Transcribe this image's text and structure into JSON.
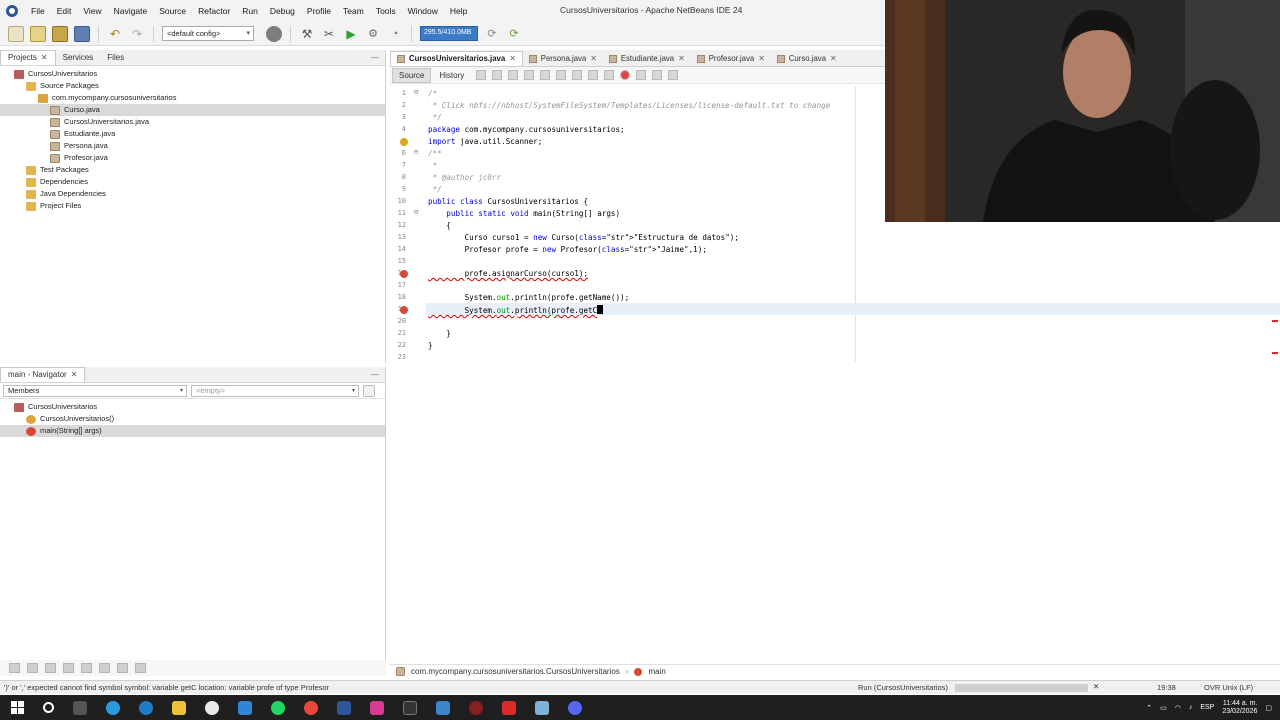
{
  "app": {
    "window_title": "CursosUniversitarios - Apache NetBeans IDE 24"
  },
  "menu": {
    "items": [
      "File",
      "Edit",
      "View",
      "Navigate",
      "Source",
      "Refactor",
      "Run",
      "Debug",
      "Profile",
      "Team",
      "Tools",
      "Window",
      "Help"
    ]
  },
  "toolbar": {
    "config_value": "<default config>",
    "memory_label": "295.5/410.0MB"
  },
  "projects_pane": {
    "tabs": [
      "Projects",
      "Services",
      "Files"
    ],
    "tree": [
      {
        "label": "CursosUniversitarios",
        "indent": 0
      },
      {
        "label": "Source Packages",
        "indent": 1
      },
      {
        "label": "com.mycompany.cursosuniversitarios",
        "indent": 2
      },
      {
        "label": "Curso.java",
        "indent": 3,
        "selected": true
      },
      {
        "label": "CursosUniversitarios.java",
        "indent": 3
      },
      {
        "label": "Estudiante.java",
        "indent": 3
      },
      {
        "label": "Persona.java",
        "indent": 3
      },
      {
        "label": "Profesor.java",
        "indent": 3
      },
      {
        "label": "Test Packages",
        "indent": 1
      },
      {
        "label": "Dependencies",
        "indent": 1
      },
      {
        "label": "Java Dependencies",
        "indent": 1
      },
      {
        "label": "Project Files",
        "indent": 1
      }
    ]
  },
  "navigator": {
    "title": "main - Navigator",
    "filter": "Members",
    "empty_select": "<empty>",
    "tree": [
      {
        "label": "CursosUniversitarios",
        "indent": 0
      },
      {
        "label": "CursosUniversitarios()",
        "indent": 1
      },
      {
        "label": "main(String[] args)",
        "indent": 1,
        "selected": true
      }
    ]
  },
  "editor": {
    "tabs": [
      {
        "label": "CursosUniversitarios.java",
        "active": true
      },
      {
        "label": "Persona.java"
      },
      {
        "label": "Estudiante.java"
      },
      {
        "label": "Profesor.java"
      },
      {
        "label": "Curso.java"
      }
    ],
    "subtabs": [
      "Source",
      "History"
    ],
    "lines": [
      {
        "n": "1",
        "text": "/*"
      },
      {
        "n": "2",
        "text": " * Click nbfs://nbhost/SystemFileSystem/Templates/Licenses/license-default.txt to change"
      },
      {
        "n": "3",
        "text": " */"
      },
      {
        "n": "4",
        "text": "package com.mycompany.cursosuniversitarios;"
      },
      {
        "n": "5",
        "text": "import java.util.Scanner;"
      },
      {
        "n": "6",
        "text": "/**"
      },
      {
        "n": "7",
        "text": " *"
      },
      {
        "n": "8",
        "text": " * @author jc0rr"
      },
      {
        "n": "9",
        "text": " */"
      },
      {
        "n": "10",
        "text": "public class CursosUniversitarios {"
      },
      {
        "n": "11",
        "text": "    public static void main(String[] args)"
      },
      {
        "n": "12",
        "text": "    {"
      },
      {
        "n": "13",
        "text": "        Curso curso1 = new Curso(\"Estructura de datos\");"
      },
      {
        "n": "14",
        "text": "        Profesor profe = new Profesor(\"Jaime\",1);"
      },
      {
        "n": "15",
        "text": ""
      },
      {
        "n": "16",
        "text": "        profe.asignarCurso(curso1);"
      },
      {
        "n": "17",
        "text": ""
      },
      {
        "n": "18",
        "text": "        System.out.println(profe.getName());"
      },
      {
        "n": "19",
        "text": "        System.out.println(profe.getC"
      },
      {
        "n": "20",
        "text": ""
      },
      {
        "n": "21",
        "text": "    }"
      },
      {
        "n": "22",
        "text": "}"
      },
      {
        "n": "23",
        "text": ""
      }
    ]
  },
  "breadcrumb": {
    "path": "com.mycompany.cursosuniversitarios.CursosUniversitarios",
    "method": "main"
  },
  "statusbar": {
    "message": "')' or ',' expected  cannot find symbol   symbol:   variable getC   location: variable profe of type Profesor",
    "run_label": "Run (CursosUniversitarios)",
    "position": "19:38",
    "mode": "OVR Unix (LF)"
  },
  "taskbar": {
    "lang": "ESP",
    "time": "11:44 a. m.",
    "date": "23/02/2026"
  },
  "colors": {
    "accent_blue": "#3a7ac8",
    "error_red": "#d34a3c",
    "keyword": "#0000e6",
    "string": "#ce7b00"
  }
}
